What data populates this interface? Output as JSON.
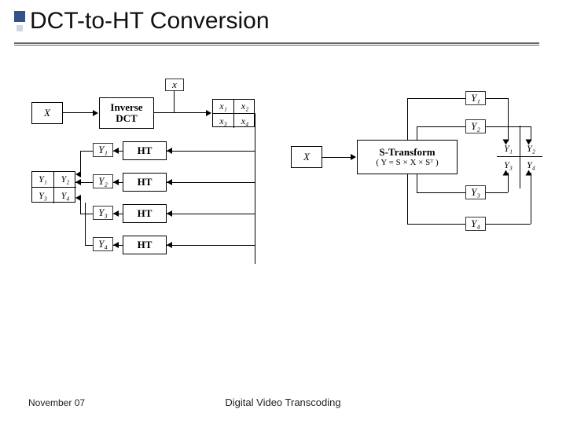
{
  "slide": {
    "title": "DCT-to-HT Conversion",
    "footer_date": "November 07",
    "footer_title": "Digital Video Transcoding"
  },
  "left_diagram": {
    "X": "X",
    "inverse_dct": "Inverse\nDCT",
    "x_top": "x",
    "ht": "HT",
    "x_quad": {
      "tl": "x₁",
      "tr": "x₂",
      "bl": "x₃",
      "br": "x₄"
    },
    "y_mini": {
      "a": "Y₁",
      "b": "Y₂",
      "c": "Y₃",
      "d": "Y₄"
    },
    "y_quad": {
      "tl": "Y₁",
      "tr": "Y₂",
      "bl": "Y₃",
      "br": "Y₄"
    }
  },
  "right_diagram": {
    "X": "X",
    "stransform_title": "S-Transform",
    "stransform_sub": "( Y = S × X × Sᵀ )",
    "y_mini": {
      "a": "Y₁",
      "b": "Y₂",
      "c": "Y₃",
      "d": "Y₄"
    },
    "y_quad": {
      "tl": "Y₁",
      "tr": "Y₂",
      "bl": "Y₃",
      "br": "Y₄"
    }
  }
}
